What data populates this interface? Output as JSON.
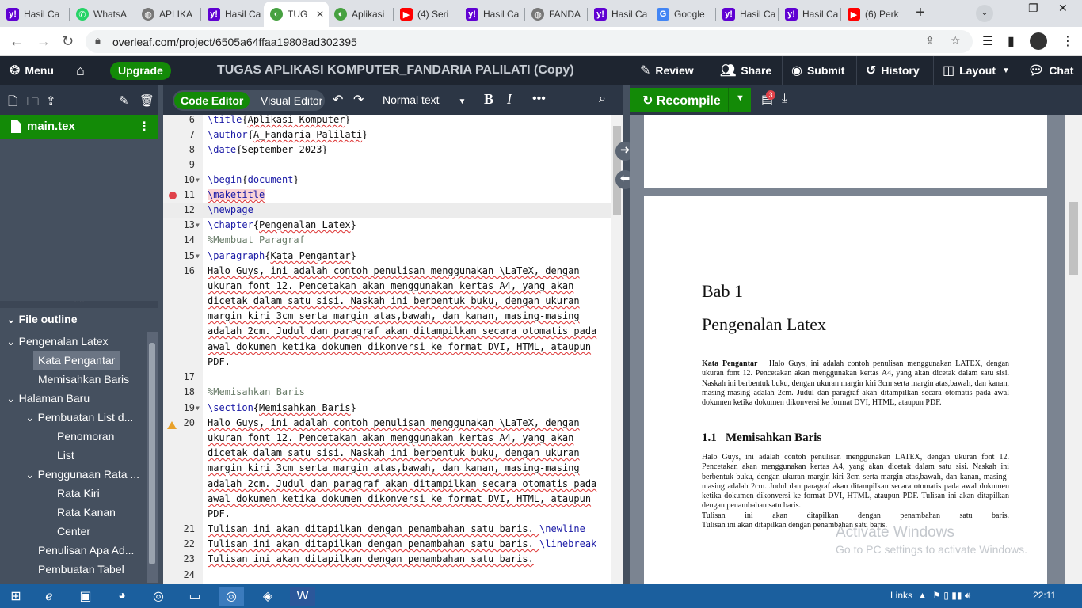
{
  "browser": {
    "tabs": [
      {
        "label": "Hasil Ca",
        "icon": "yahoo-icon",
        "color": "#6001d2"
      },
      {
        "label": "WhatsA",
        "icon": "whatsapp-icon",
        "color": "#25d366"
      },
      {
        "label": "APLIKA",
        "icon": "globe-icon",
        "color": "#666666"
      },
      {
        "label": "Hasil Ca",
        "icon": "yahoo-icon",
        "color": "#6001d2"
      },
      {
        "label": "TUG",
        "icon": "overleaf-icon",
        "color": "#47a141"
      },
      {
        "label": "Aplikasi",
        "icon": "overleaf-icon",
        "color": "#47a141"
      },
      {
        "label": "(4) Seri",
        "icon": "youtube-icon",
        "color": "#ff0000"
      },
      {
        "label": "Hasil Ca",
        "icon": "yahoo-icon",
        "color": "#6001d2"
      },
      {
        "label": "FANDA",
        "icon": "globe-icon",
        "color": "#666666"
      },
      {
        "label": "Hasil Ca",
        "icon": "yahoo-icon",
        "color": "#6001d2"
      },
      {
        "label": "Google",
        "icon": "google-icon",
        "color": "#4285f4"
      },
      {
        "label": "Hasil Ca",
        "icon": "yahoo-icon",
        "color": "#6001d2"
      },
      {
        "label": "Hasil Ca",
        "icon": "yahoo-icon",
        "color": "#6001d2"
      },
      {
        "label": "(6) Perk",
        "icon": "youtube-icon",
        "color": "#ff0000"
      }
    ],
    "url": "overleaf.com/project/6505a64ffaa19808ad302395"
  },
  "overleaf": {
    "menu": "Menu",
    "upgrade": "Upgrade",
    "project_title": "TUGAS APLIKASI KOMPUTER_FANDARIA PALILATI (Copy)",
    "review": "Review",
    "share": "Share",
    "submit": "Submit",
    "history": "History",
    "layout": "Layout",
    "chat": "Chat",
    "code_editor": "Code Editor",
    "visual_editor": "Visual Editor",
    "style_select": "Normal text",
    "recompile": "Recompile",
    "log_count": "3",
    "accent": "#138a07"
  },
  "files": {
    "current": "main.tex"
  },
  "outline": {
    "header": "File outline",
    "items": [
      "Pengenalan Latex",
      "Kata Pengantar",
      "Memisahkan Baris",
      "Halaman Baru",
      "Pembuatan List d...",
      "Penomoran",
      "List",
      "Penggunaan Rata ...",
      "Rata Kiri",
      "Rata Kanan",
      "Center",
      "Penulisan Apa Ad...",
      "Pembuatan Tabel"
    ]
  },
  "editor": {
    "line_numbers": [
      "6",
      "7",
      "8",
      "9",
      "10",
      "11",
      "12",
      "13",
      "14",
      "15",
      "16",
      "17",
      "18",
      "19",
      "20",
      "21",
      "22",
      "23",
      "24"
    ],
    "lines": [
      {
        "cmd": "\\title",
        "arg": "Aplikasi Komputer"
      },
      {
        "cmd": "\\author",
        "arg": "A_Fandaria Palilati"
      },
      {
        "cmd": "\\date",
        "arg": "September 2023"
      },
      {
        "cmd": "\\begin",
        "arg": "document"
      },
      {
        "text": "\\maketitle"
      },
      {
        "text": "\\newpage"
      },
      {
        "cmd": "\\chapter",
        "arg": "Pengenalan Latex"
      },
      {
        "text": "%Membuat Paragraf"
      },
      {
        "cmd": "\\paragraph",
        "arg": "Kata Pengantar"
      },
      {
        "text": "%Memisahkan Baris"
      },
      {
        "cmd": "\\section",
        "arg": "Memisahkan Baris"
      }
    ],
    "para_16": [
      "Halo Guys, ini adalah contoh penulisan menggunakan \\LaTeX, dengan",
      "ukuran font 12. Pencetakan akan menggunakan kertas A4, yang akan",
      "dicetak dalam satu sisi. Naskah ini berbentuk buku, dengan ukuran",
      "margin kiri 3cm serta margin atas,bawah, dan kanan, masing-masing",
      "adalah 2cm. Judul dan paragraf akan ditampilkan secara otomatis pada",
      "awal dokumen ketika dokumen dikonversi ke format DVI, HTML, ataupun",
      "PDF."
    ],
    "para_20": [
      "Halo Guys, ini adalah contoh penulisan menggunakan \\LaTeX, dengan",
      "ukuran font 12. Pencetakan akan menggunakan kertas A4, yang akan",
      "dicetak dalam satu sisi. Naskah ini berbentuk buku, dengan ukuran",
      "margin kiri 3cm serta margin atas,bawah, dan kanan, masing-masing",
      "adalah 2cm. Judul dan paragraf akan ditampilkan secara otomatis pada",
      "awal dokumen ketika dokumen dikonversi ke format DVI, HTML, ataupun",
      "PDF."
    ],
    "line_21": "Tulisan ini akan ditapilkan dengan penambahan satu baris. ",
    "line_21_cmd": "\\newline",
    "line_22": "Tulisan ini akan ditapilkan dengan penambahan satu baris. ",
    "line_22_cmd": "\\linebreak",
    "line_23": "Tulisan ini akan ditapilkan dengan penambahan satu baris."
  },
  "pdf": {
    "chapter": "Bab 1",
    "chapter_title": "Pengenalan Latex",
    "para_head": "Kata Pengantar",
    "para_text": "Halo Guys, ini adalah contoh penulisan menggunakan LATEX, dengan ukuran font 12. Pencetakan akan menggunakan kertas A4, yang akan dicetak dalam satu sisi. Naskah ini berbentuk buku, dengan ukuran margin kiri 3cm serta margin atas,bawah, dan kanan, masing-masing adalah 2cm. Judul dan paragraf akan ditampilkan secara otomatis pada awal dokumen ketika dokumen dikonversi ke format DVI, HTML, ataupun PDF.",
    "section_num": "1.1",
    "section_title": "Memisahkan Baris",
    "section_text": "Halo Guys, ini adalah contoh penulisan menggunakan LATEX, dengan ukuran font 12. Pencetakan akan menggunakan kertas A4, yang akan dicetak dalam satu sisi. Naskah ini berbentuk buku, dengan ukuran margin kiri 3cm serta margin atas,bawah, dan kanan, masing-masing adalah 2cm. Judul dan paragraf akan ditampilkan secara otomatis pada awal dokumen ketika dokumen dikonversi ke format DVI, HTML, ataupun PDF. Tulisan ini akan ditapilkan dengan penambahan satu baris.",
    "line_a": "Tulisan ini akan ditapilkan dengan penambahan satu baris.",
    "line_b": "Tulisan ini akan ditapilkan dengan penambahan satu baris."
  },
  "watermark": {
    "line1": "Activate Windows",
    "line2": "Go to PC settings to activate Windows."
  },
  "taskbar": {
    "links": "Links",
    "time": "22:11"
  }
}
